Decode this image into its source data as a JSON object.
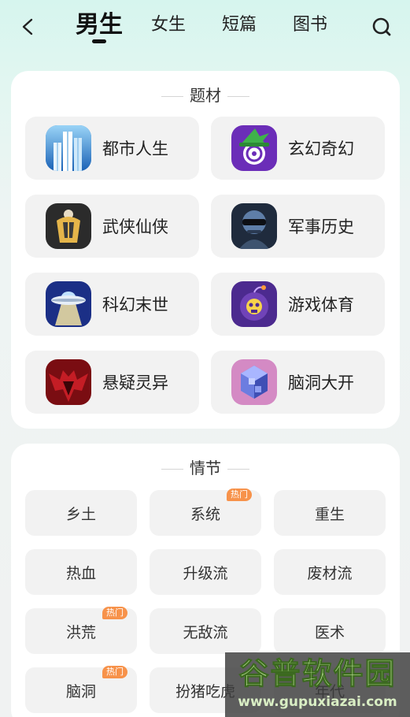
{
  "nav": {
    "tabs": [
      {
        "label": "男生",
        "active": true
      },
      {
        "label": "女生",
        "active": false
      },
      {
        "label": "短篇",
        "active": false
      },
      {
        "label": "图书",
        "active": false
      }
    ],
    "back_icon": "back-arrow-icon",
    "search_icon": "search-icon"
  },
  "genre_section": {
    "title": "题材",
    "items": [
      {
        "label": "都市人生",
        "icon": "city-skyscraper-icon"
      },
      {
        "label": "玄幻奇幻",
        "icon": "wizard-hat-icon"
      },
      {
        "label": "武侠仙侠",
        "icon": "swordsman-icon"
      },
      {
        "label": "军事历史",
        "icon": "soldier-icon"
      },
      {
        "label": "科幻末世",
        "icon": "ufo-icon"
      },
      {
        "label": "游戏体育",
        "icon": "skull-bomb-icon"
      },
      {
        "label": "悬疑灵异",
        "icon": "bat-demon-icon"
      },
      {
        "label": "脑洞大开",
        "icon": "cube-icon"
      }
    ]
  },
  "plot_section": {
    "title": "情节",
    "hot_label": "热门",
    "tags": [
      {
        "label": "乡土",
        "hot": false
      },
      {
        "label": "系统",
        "hot": true
      },
      {
        "label": "重生",
        "hot": false
      },
      {
        "label": "热血",
        "hot": false
      },
      {
        "label": "升级流",
        "hot": false
      },
      {
        "label": "废材流",
        "hot": false
      },
      {
        "label": "洪荒",
        "hot": true
      },
      {
        "label": "无敌流",
        "hot": false
      },
      {
        "label": "医术",
        "hot": false
      },
      {
        "label": "脑洞",
        "hot": true
      },
      {
        "label": "扮猪吃虎",
        "hot": false
      },
      {
        "label": "年代",
        "hot": false
      }
    ]
  },
  "watermark": {
    "title": "谷普软件园",
    "url": "www.gupuxiazai.com"
  },
  "colors": {
    "hot_badge": "#f7924a",
    "card_bg": "#ffffff",
    "tile_bg": "#f2f2f2"
  }
}
